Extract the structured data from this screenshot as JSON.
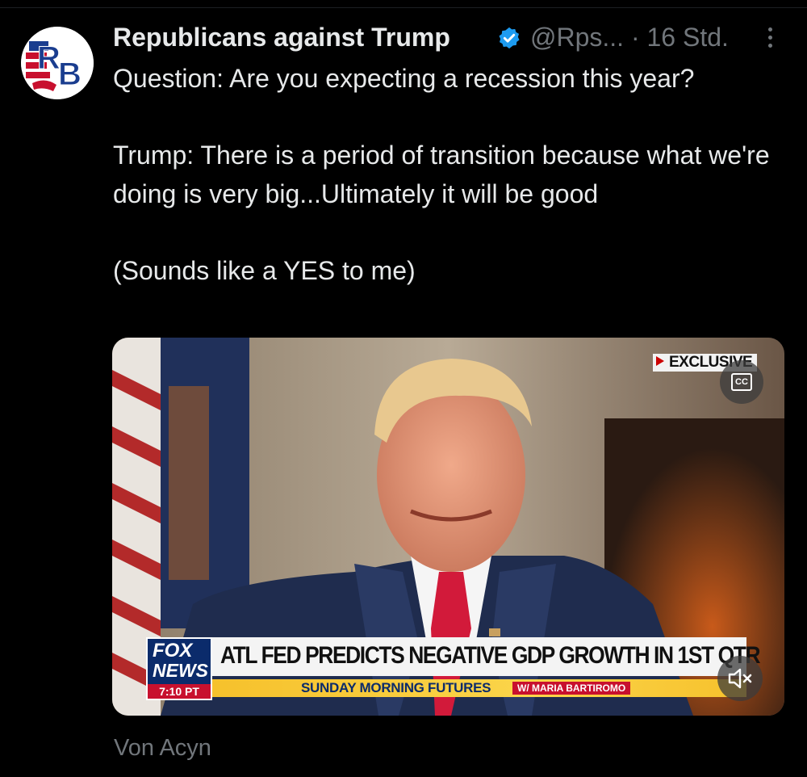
{
  "tweet": {
    "author": {
      "display_name": "Republicans against Trump",
      "handle": "@Rps...",
      "verified": true,
      "avatar_initials": "RB",
      "timestamp": "16 Std.",
      "separator": "·"
    },
    "text": "Question: Are you expecting a recession this year?\n\nTrump: There is a period of transition because what we're doing is very big...Ultimately it will be good\n\n(Sounds like a YES to me)",
    "source_label": "Von Acyn"
  },
  "video": {
    "exclusive_badge": "EXCLUSIVE",
    "cc_label": "CC",
    "chyron": {
      "network_line1": "FOX",
      "network_line2": "NEWS",
      "time": "7:10 PT",
      "headline": "ATL FED PREDICTS NEGATIVE GDP GROWTH IN 1ST QTR",
      "show_name": "SUNDAY MORNING FUTURES",
      "host": "W/ MARIA BARTIROMO"
    },
    "icons": {
      "captions": "closed-captions-icon",
      "mute": "speaker-muted-icon"
    }
  },
  "colors": {
    "background": "#000000",
    "text_primary": "#e7e9ea",
    "text_secondary": "#71767b",
    "verified_blue": "#1d9bf0"
  }
}
